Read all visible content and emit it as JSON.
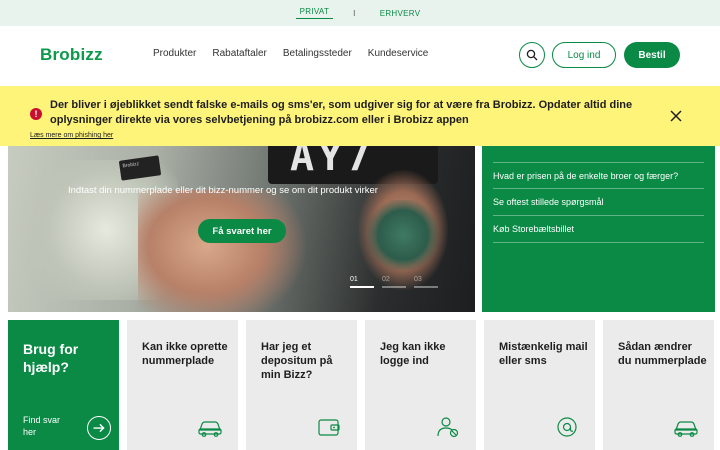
{
  "topbar": {
    "private_label": "PRIVAT",
    "separator": "I",
    "business_label": "ERHVERV"
  },
  "header": {
    "logo": "Brobizz",
    "nav": [
      "Produkter",
      "Rabataftaler",
      "Betalingssteder",
      "Kundeservice"
    ],
    "login_label": "Log ind",
    "buy_label": "Bestil"
  },
  "alert": {
    "message": "Der bliver i øjeblikket sendt falske e-mails og sms'er, som udgiver sig for at være fra Brobizz. Opdater altid dine oplysninger direkte via vores selvbetjening på brobizz.com eller i Brobizz appen",
    "link": "Læs mere om phishing her",
    "icon": "warning-icon",
    "color": "#fff47a"
  },
  "hero": {
    "subtitle": "Indtast din nummerplade eller dit bizz-nummer og se om dit produkt virker",
    "cta_label": "Få svaret her",
    "plate_text": "AY7",
    "bizz_label": "Brobizz",
    "slides": [
      "01",
      "02",
      "03"
    ],
    "active_slide": "01"
  },
  "faq": {
    "items": [
      "Hvad er prisen på de enkelte broer og færger?",
      "Se oftest stillede spørgsmål",
      "Køb Storebæltsbillet"
    ]
  },
  "tiles": {
    "help": {
      "title": "Brug for hjælp?",
      "find_label": "Find svar her"
    },
    "items": [
      {
        "title": "Kan ikke oprette nummerplade",
        "icon": "car-icon"
      },
      {
        "title": "Har jeg et depositum på min Bizz?",
        "icon": "wallet-icon"
      },
      {
        "title": "Jeg kan ikke logge ind",
        "icon": "user-blocked-icon"
      },
      {
        "title": "Mistænkelig mail eller sms",
        "icon": "at-sign-icon"
      },
      {
        "title": "Sådan ændrer du nummerplade",
        "icon": "car-icon"
      }
    ]
  },
  "colors": {
    "brand": "#0a8a45",
    "alert_bg": "#fff47a",
    "tile_bg": "#ebebeb"
  }
}
